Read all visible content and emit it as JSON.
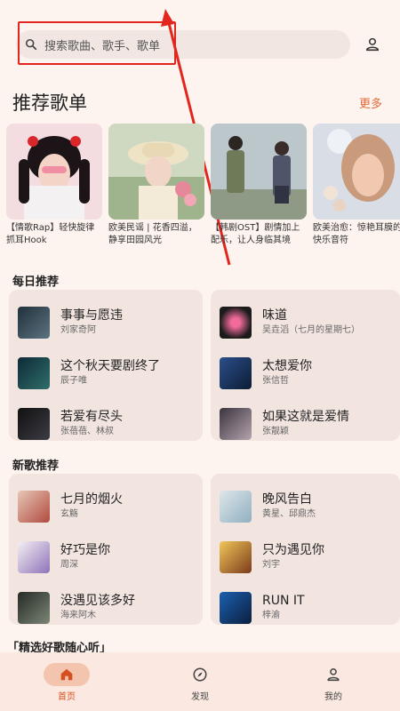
{
  "search": {
    "placeholder": "搜索歌曲、歌手、歌单"
  },
  "recommended_playlists": {
    "title": "推荐歌单",
    "more_label": "更多",
    "items": [
      {
        "title": "【情歌Rap】轻快旋律抓耳Hook"
      },
      {
        "title": "欧美民谣 | 花香四溢，静享田园风光"
      },
      {
        "title": "【韩剧OST】剧情加上配乐，让人身临其境"
      },
      {
        "title": "欧美治愈：惊艳耳膜的快乐音符"
      }
    ]
  },
  "daily": {
    "title": "每日推荐",
    "left": [
      {
        "title": "事事与愿违",
        "artist": "刘家奇阿"
      },
      {
        "title": "这个秋天要剧终了",
        "artist": "辰子唯"
      },
      {
        "title": "若爱有尽头",
        "artist": "张蓓蓓、林叔"
      }
    ],
    "right": [
      {
        "title": "味道",
        "artist": "吴垚滔（七月的星期七）"
      },
      {
        "title": "太想爱你",
        "artist": "张信哲"
      },
      {
        "title": "如果这就是爱情",
        "artist": "张靓颖"
      }
    ]
  },
  "new_songs": {
    "title": "新歌推荐",
    "left": [
      {
        "title": "七月的烟火",
        "artist": "玄觞"
      },
      {
        "title": "好巧是你",
        "artist": "周深"
      },
      {
        "title": "没遇见该多好",
        "artist": "海来阿木"
      }
    ],
    "right": [
      {
        "title": "晚风告白",
        "artist": "黄星、邱鼎杰"
      },
      {
        "title": "只为遇见你",
        "artist": "刘宇"
      },
      {
        "title": "RUN IT",
        "artist": "梓渝"
      }
    ]
  },
  "selected": {
    "title": "「精选好歌随心听」"
  },
  "nav": [
    {
      "label": "首页",
      "icon": "home-icon"
    },
    {
      "label": "发现",
      "icon": "compass-icon"
    },
    {
      "label": "我的",
      "icon": "person-icon"
    }
  ],
  "colors": {
    "accent": "#e26a3b",
    "annotation": "#e2261d",
    "nav_active_bg": "#f3c4ae"
  }
}
